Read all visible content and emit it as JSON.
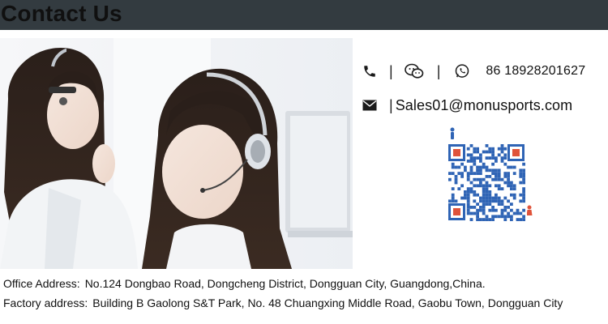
{
  "header": {
    "title": "Contact Us"
  },
  "contact": {
    "phone_separator_1": "|",
    "phone_separator_2": "|",
    "phone_number": "86 18928201627",
    "email_separator": "|",
    "email": "Sales01@monusports.com",
    "icons": [
      "phone-icon",
      "wechat-icon",
      "whatsapp-icon",
      "mail-icon",
      "qr-code"
    ]
  },
  "addresses": {
    "office_label": "Office Address:",
    "office_value": "No.124 Dongbao Road, Dongcheng District, Dongguan City, Guangdong,China.",
    "factory_label": "Factory address:",
    "factory_value": "Building B Gaolong S&T Park, No. 48 Chuangxing Middle Road, Gaobu Town, Dongguan City"
  },
  "colors": {
    "header_bar": "#333b40",
    "qr_blue": "#2f64b5",
    "qr_accent": "#e0533a"
  }
}
